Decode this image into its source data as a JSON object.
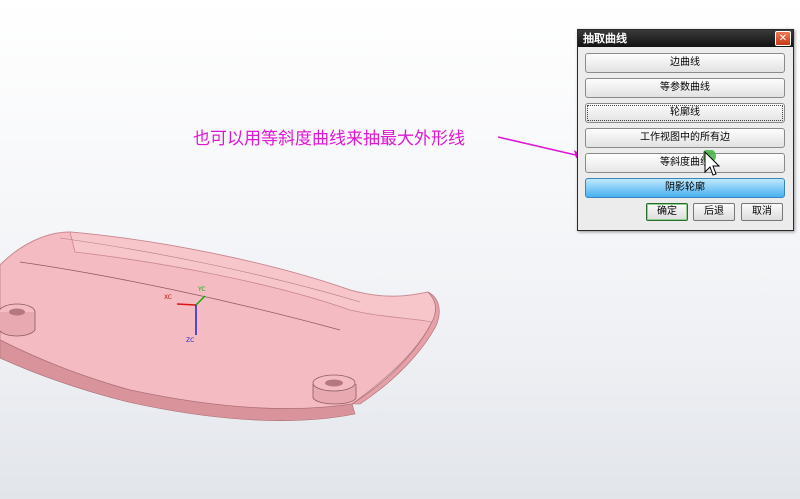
{
  "dialog": {
    "title": "抽取曲线",
    "close_icon": "close-icon",
    "options": [
      {
        "label": "边曲线"
      },
      {
        "label": "等参数曲线"
      },
      {
        "label": "轮廓线"
      },
      {
        "label": "工作视图中的所有边"
      },
      {
        "label": "等斜度曲线"
      },
      {
        "label": "阴影轮廓"
      }
    ],
    "ok_label": "确定",
    "back_label": "后退",
    "cancel_label": "取消"
  },
  "annotation": {
    "text": "也可以用等斜度曲线来抽最大外形线",
    "color": "#e016d6"
  },
  "triad": {
    "xc": "XC",
    "yc": "YC",
    "zc": "ZC"
  },
  "colors": {
    "part_body": "#f2b7bd",
    "part_side": "#d9939b",
    "selected_button": "#49b0ef"
  }
}
